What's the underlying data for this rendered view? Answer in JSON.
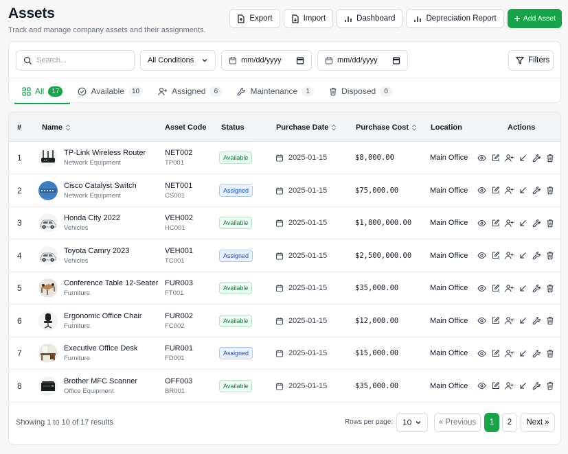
{
  "page": {
    "title": "Assets",
    "subtitle": "Track and manage company assets and their assignments."
  },
  "toolbar": {
    "export": "Export",
    "import": "Import",
    "dashboard": "Dashboard",
    "depreciation": "Depreciation Report",
    "add": "Add Asset"
  },
  "filters": {
    "search_placeholder": "Search...",
    "condition": "All Conditions",
    "date_from": "mm/dd/yyyy",
    "date_to": "mm/dd/yyyy",
    "filters_label": "Filters"
  },
  "tabs": [
    {
      "label": "All",
      "count": "17"
    },
    {
      "label": "Available",
      "count": "10"
    },
    {
      "label": "Assigned",
      "count": "6"
    },
    {
      "label": "Maintenance",
      "count": "1"
    },
    {
      "label": "Disposed",
      "count": "0"
    }
  ],
  "table": {
    "headers": {
      "num": "#",
      "name": "Name",
      "code": "Asset Code",
      "status": "Status",
      "date": "Purchase Date",
      "cost": "Purchase Cost",
      "location": "Location",
      "actions": "Actions"
    },
    "rows": [
      {
        "num": "1",
        "name": "TP-Link Wireless Router",
        "category": "Network Equipment",
        "code": "NET002",
        "tag": "TP001",
        "status": "Available",
        "date": "2025-01-15",
        "cost": "$8,000.00",
        "location": "Main Office",
        "icon": "router"
      },
      {
        "num": "2",
        "name": "Cisco Catalyst Switch",
        "category": "Network Equipment",
        "code": "NET001",
        "tag": "CS001",
        "status": "Assigned",
        "date": "2025-01-15",
        "cost": "$75,000.00",
        "location": "Main Office",
        "icon": "switch"
      },
      {
        "num": "3",
        "name": "Honda City 2022",
        "category": "Vehicles",
        "code": "VEH002",
        "tag": "HC001",
        "status": "Available",
        "date": "2025-01-15",
        "cost": "$1,800,000.00",
        "location": "Main Office",
        "icon": "car"
      },
      {
        "num": "4",
        "name": "Toyota Camry 2023",
        "category": "Vehicles",
        "code": "VEH001",
        "tag": "TC001",
        "status": "Assigned",
        "date": "2025-01-15",
        "cost": "$2,500,000.00",
        "location": "Main Office",
        "icon": "car"
      },
      {
        "num": "5",
        "name": "Conference Table 12-Seater",
        "category": "Furniture",
        "code": "FUR003",
        "tag": "FT001",
        "status": "Available",
        "date": "2025-01-15",
        "cost": "$35,000.00",
        "location": "Main Office",
        "icon": "table"
      },
      {
        "num": "6",
        "name": "Ergonomic Office Chair",
        "category": "Furniture",
        "code": "FUR002",
        "tag": "FC002",
        "status": "Available",
        "date": "2025-01-15",
        "cost": "$12,000.00",
        "location": "Main Office",
        "icon": "chair"
      },
      {
        "num": "7",
        "name": "Executive Office Desk",
        "category": "Furniture",
        "code": "FUR001",
        "tag": "FD001",
        "status": "Assigned",
        "date": "2025-01-15",
        "cost": "$15,000.00",
        "location": "Main Office",
        "icon": "desk"
      },
      {
        "num": "8",
        "name": "Brother MFC Scanner",
        "category": "Office Equipment",
        "code": "OFF003",
        "tag": "BR001",
        "status": "Available",
        "date": "2025-01-15",
        "cost": "$35,000.00",
        "location": "Main Office",
        "icon": "scanner"
      }
    ]
  },
  "footer": {
    "showing": "Showing 1 to 10 of 17 results",
    "rows_per_page_label": "Rows per page:",
    "rows_per_page": "10",
    "prev": "« Previous",
    "page1": "1",
    "page2": "2",
    "next": "Next »"
  }
}
